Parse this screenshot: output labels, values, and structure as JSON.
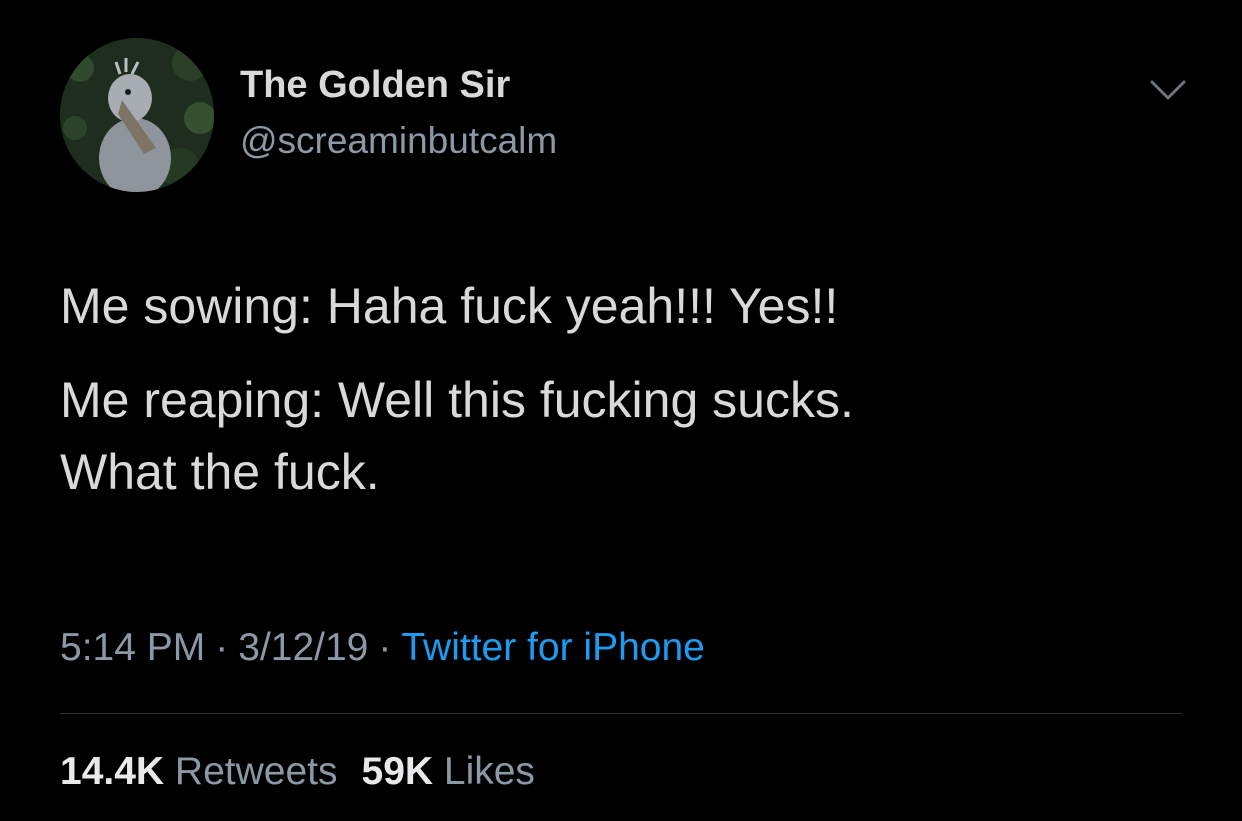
{
  "author": {
    "display_name": "The Golden Sir",
    "handle": "@screaminbutcalm",
    "avatar_icon": "shoebill-bird-avatar"
  },
  "menu_icon": "chevron-down-icon",
  "tweet": {
    "line1": "Me sowing: Haha fuck yeah!!! Yes!!",
    "line2": "Me reaping: Well this fucking sucks.",
    "line3": "What the fuck."
  },
  "meta": {
    "time": "5:14 PM",
    "separator": "·",
    "date": "3/12/19",
    "source": "Twitter for iPhone"
  },
  "stats": {
    "retweets_count": "14.4K",
    "retweets_label": "Retweets",
    "likes_count": "59K",
    "likes_label": "Likes"
  },
  "colors": {
    "background": "#000000",
    "primary_text": "#d9d9d9",
    "secondary_text": "#8b98a5",
    "link": "#1d9bf0",
    "divider": "#2f3336"
  }
}
